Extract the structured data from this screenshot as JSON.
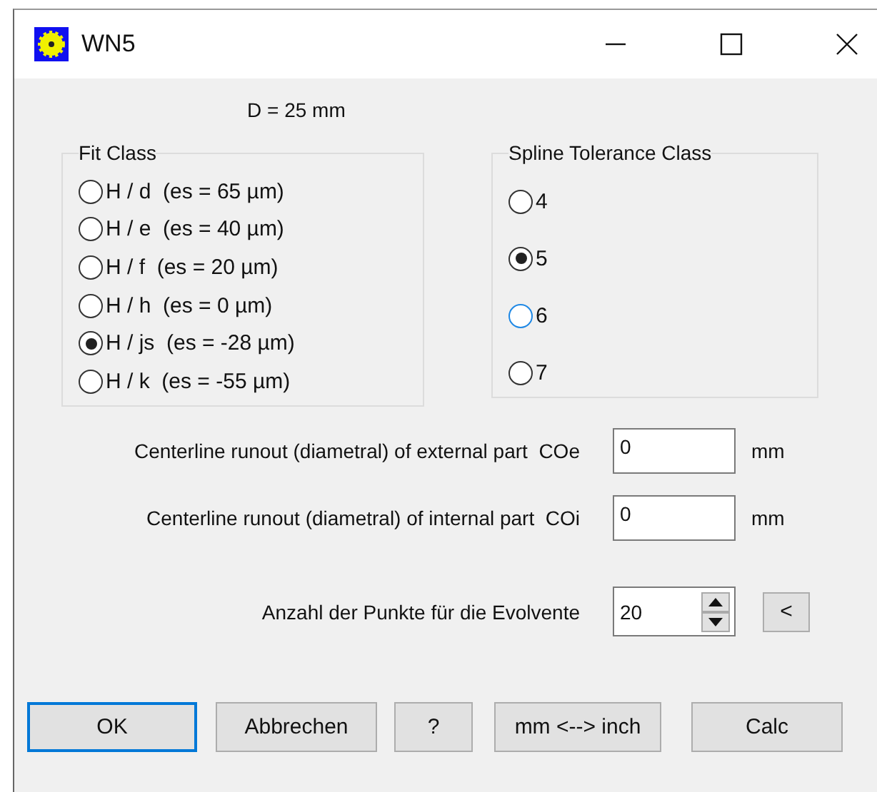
{
  "window": {
    "title": "WN5"
  },
  "diameter_label": "D = 25 mm",
  "fit_class": {
    "title": "Fit Class",
    "options": [
      {
        "label": "H / d  (es = 65 µm)",
        "selected": false
      },
      {
        "label": "H / e  (es = 40 µm)",
        "selected": false
      },
      {
        "label": "H / f  (es = 20 µm)",
        "selected": false
      },
      {
        "label": "H / h  (es = 0 µm)",
        "selected": false
      },
      {
        "label": "H / js  (es = -28 µm)",
        "selected": true
      },
      {
        "label": "H / k  (es = -55 µm)",
        "selected": false
      }
    ]
  },
  "spline_tolerance_class": {
    "title": "Spline Tolerance Class",
    "options": [
      {
        "label": "4",
        "selected": false,
        "focused": false
      },
      {
        "label": "5",
        "selected": true,
        "focused": false
      },
      {
        "label": "6",
        "selected": false,
        "focused": true
      },
      {
        "label": "7",
        "selected": false,
        "focused": false
      }
    ]
  },
  "fields": [
    {
      "kind": "text",
      "label": "Centerline runout (diametral) of external part  COe",
      "value": "0",
      "unit": "mm"
    },
    {
      "kind": "text",
      "label": "Centerline runout (diametral) of internal part  COi",
      "value": "0",
      "unit": "mm"
    },
    {
      "kind": "spinner",
      "label": "Anzahl der Punkte für die Evolvente",
      "value": "20",
      "button": "<"
    }
  ],
  "buttons": [
    {
      "label": "OK",
      "default": true
    },
    {
      "label": "Abbrechen",
      "default": false
    },
    {
      "label": "?",
      "default": false
    },
    {
      "label": "mm <--> inch",
      "default": false
    },
    {
      "label": "Calc",
      "default": false
    }
  ]
}
